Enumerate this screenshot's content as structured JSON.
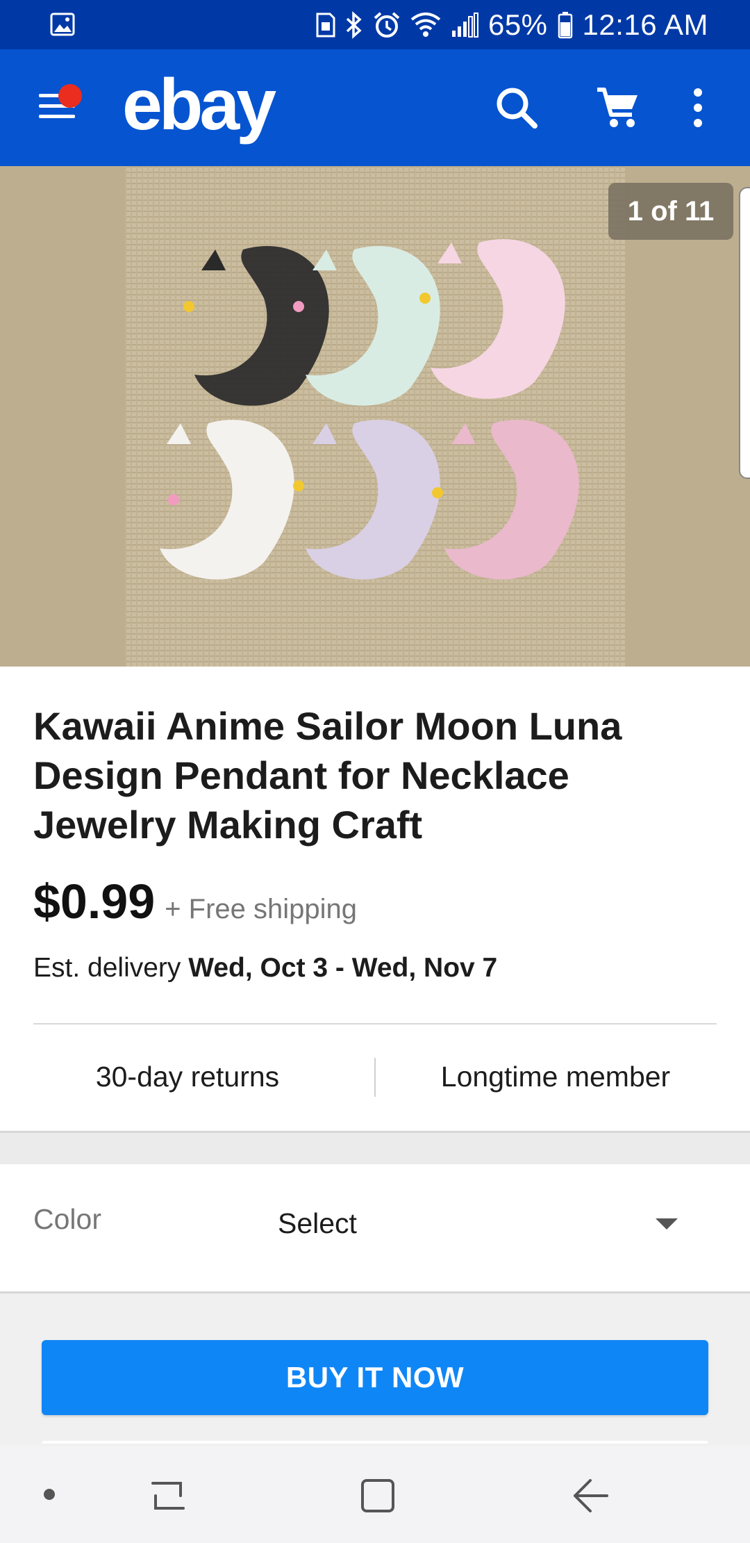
{
  "status_bar": {
    "battery": "65%",
    "time": "12:16 AM",
    "icons": [
      "gallery-notification-icon",
      "sim-icon",
      "bluetooth-icon",
      "alarm-icon",
      "wifi-icon",
      "signal-icon",
      "battery-icon"
    ]
  },
  "app_bar": {
    "brand": "ebay",
    "icons": [
      "menu-icon",
      "search-icon",
      "cart-icon",
      "more-vertical-icon"
    ],
    "colors": {
      "background": "#0654d0",
      "status": "#0039a6",
      "notification_dot": "#ea2d1e"
    }
  },
  "gallery": {
    "counter": "1 of 11"
  },
  "listing": {
    "title": "Kawaii Anime Sailor Moon Luna Design Pendant for Necklace Jewelry Making Craft",
    "price": "$0.99",
    "shipping": "+ Free shipping",
    "delivery_prefix": "Est. delivery",
    "delivery_range": "Wed, Oct 3 - Wed, Nov 7",
    "badges": {
      "returns": "30-day returns",
      "member": "Longtime member"
    }
  },
  "variation": {
    "label": "Color",
    "value": "Select"
  },
  "actions": {
    "buy_now": "BUY IT NOW",
    "buy_color": "#0f86f6"
  },
  "nav_bar": {
    "icons": [
      "dot-icon",
      "recents-icon",
      "home-icon",
      "back-icon"
    ]
  }
}
